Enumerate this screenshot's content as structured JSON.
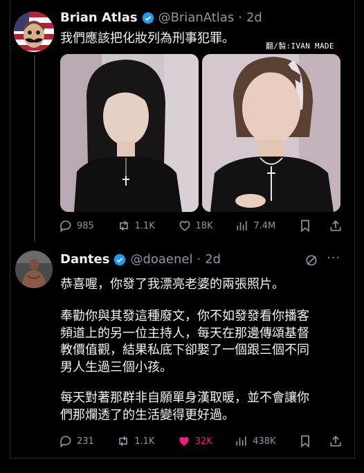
{
  "watermark": "翻/製:IVAN MADE",
  "tweet1": {
    "name": "Brian Atlas",
    "handle": "@BrianAtlas",
    "time": "2d",
    "text": "我們應該把化妝列為刑事犯罪。",
    "stats": {
      "replies": "985",
      "retweets": "1.1K",
      "likes": "18K",
      "views": "7.4M"
    }
  },
  "tweet2": {
    "name": "Dantes",
    "handle": "@doaenel",
    "time": "2d",
    "paragraphs": [
      "恭喜喔，你發了我漂亮老婆的兩張照片。",
      "奉勸你與其發這種廢文，你不如發發看你播客\n頻道上的另一位主持人，每天在那邊傳頌基督\n教價值觀，結果私底下卻娶了一個跟三個不同\n男人生過三個小孩。",
      "每天對著那群非自願單身漢取暖，並不會讓你\n們那爛透了的生活變得更好過。"
    ],
    "stats": {
      "replies": "231",
      "retweets": "1.1K",
      "likes": "32K",
      "views": "438K"
    }
  },
  "colors": {
    "background": "#000000",
    "muted": "#8b98a5",
    "verified": "#1d9bf0",
    "like_active": "#f91880"
  }
}
